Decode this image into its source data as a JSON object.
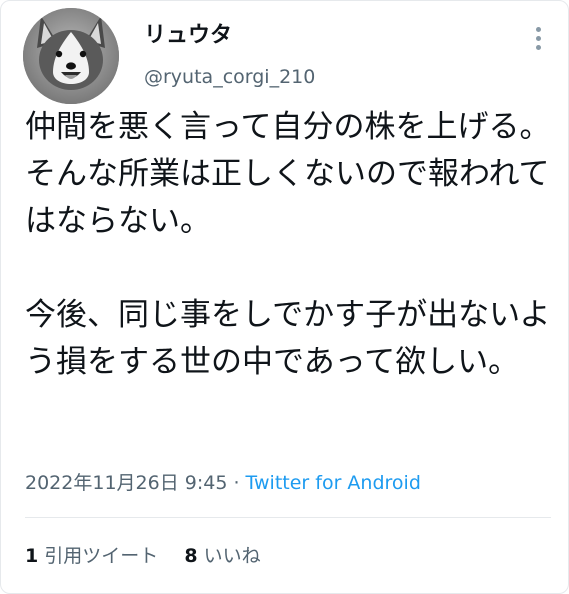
{
  "author": {
    "display_name": "リュウタ",
    "handle": "@ryuta_corgi_210"
  },
  "tweet": {
    "text": "仲間を悪く言って自分の株を上げる。\nそんな所業は正しくないので報われてはならない。\n\n今後、同じ事をしでかす子が出ないよう損をする世の中であって欲しい。"
  },
  "meta": {
    "datetime": "2022年11月26日 9:45",
    "separator": " · ",
    "source": "Twitter for Android"
  },
  "stats": {
    "quotes_count": "1",
    "quotes_label": "引用ツイート",
    "likes_count": "8",
    "likes_label": "いいね"
  },
  "icons": {
    "more": "more-options-icon",
    "avatar": "corgi-avatar-photo"
  },
  "colors": {
    "text": "#0f1419",
    "secondary": "#536471",
    "link": "#1d9bf0",
    "divider": "#e6e9ec"
  }
}
